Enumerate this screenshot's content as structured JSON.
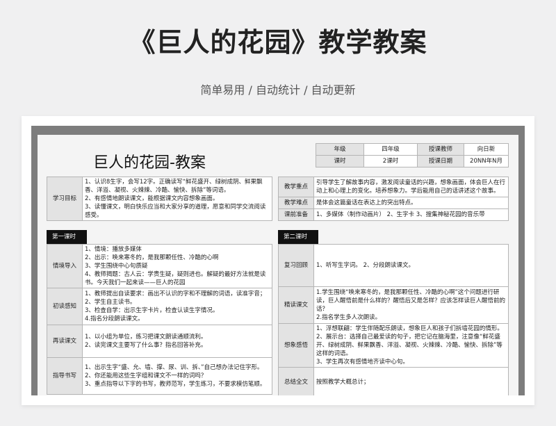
{
  "page": {
    "title": "《巨人的花园》教学教案",
    "subtitle": "简单易用 / 自动统计 / 自动更新"
  },
  "doc": {
    "title": "巨人的花园-教案",
    "info": {
      "grade_label": "年级",
      "grade_value": "四年级",
      "teacher_label": "授课教师",
      "teacher_value": "向日新",
      "hours_label": "课时",
      "hours_value": "2课时",
      "date_label": "授课日期",
      "date_value": "20NN年N月"
    },
    "goals": {
      "label": "学习目标",
      "text": "1、认识8生字，会写12字。正确读写“鲜花盛开、绿树成阴、鲜果飘香、洋溢、凝视、火辣辣、冷酷、愉快、拆除”等词语。\n2、有感情地朗读课文，能根据课文内容想象画面。\n3、读懂课文，明白快乐应当和大家分享的道理，愿意和同学交流阅读感受。"
    },
    "focus": {
      "key_label": "教学重点",
      "key_text": "引导学生了解故事内容，激发阅读童话的兴趣，想象画面，体会巨人在行动上和心理上的变化。培养想象力。学后能用自己的话讲述这个故事。",
      "diff_label": "教学难点",
      "diff_text": "是体会这篇童话在表达上的突出特点。",
      "prep_label": "课前准备",
      "prep_text": "1、多媒体（制作动画片） 2、生字卡 3、搜集神秘花园的音乐带"
    },
    "lesson1": {
      "header": "第一课时",
      "rows": [
        {
          "label": "情境导入",
          "text": "1、情境：播放多媒体\n2、出示：唤来寒冬的，是我那颗任性、冷酷的心啊\n3、学生围绕中心句质疑\n4、教师揭题：古人云：学贵生疑，疑则进也。解疑的最好方法就是读书。今天我们一起来读——巨人的花园"
        },
        {
          "label": "初读感知",
          "text": "1、教师提出自读要求：画出不认识的字和不理解的词语，读准字音；\n2、学生自主读书。\n3、检查自学：出示生字卡片，检查认读生字情况。\n4.指名分段朗读课文。"
        },
        {
          "label": "再读课文",
          "text": "1、以小组为单位，练习把课文朗读通顺流利。\n2、读完课文主要写了什么事？指名回答补充。"
        },
        {
          "label": "指导书写",
          "text": "1、出示生字“盛、允、墙、撑、尿、训、拆、”自己想办法记住字形。\n2、你还能用这些生字组和课文不一样的词吗？\n3、重点指导以下字的书写，教师范写，学生练习，不要求模仿笔顺。"
        }
      ]
    },
    "lesson2": {
      "header": "第二课时",
      "rows": [
        {
          "label": "复习回顾",
          "text": "1、听写生字词。 2、分段朗读课文。"
        },
        {
          "label": "精读课文",
          "text": "1.学生围绕“唤来寒冬的，是我那颗任性、冷酷的心啊”这个问题进行研读，巨人醒悟前是什么样的？醒悟后又是怎样？应该怎样读巨人醒悟前的话？\n2.指名学生多人次朗读。"
        },
        {
          "label": "想象感悟",
          "text": "1、浮想联翩：学生伴随配乐朗读，想象巨人和孩子们拆墙花园的情形。\n2、展示台：选择自己最爱读的句子，把它记在脑海里，注意像“鲜花盛开、绿树成阴、鲜果飘香、洋溢、凝视、火辣辣、冷酷、愉快、拆除”等这样的词语。\n3、学生再次有感情地齐读中心句。"
        },
        {
          "label": "总结全文",
          "text": "按照教学大概总计；"
        }
      ]
    }
  }
}
